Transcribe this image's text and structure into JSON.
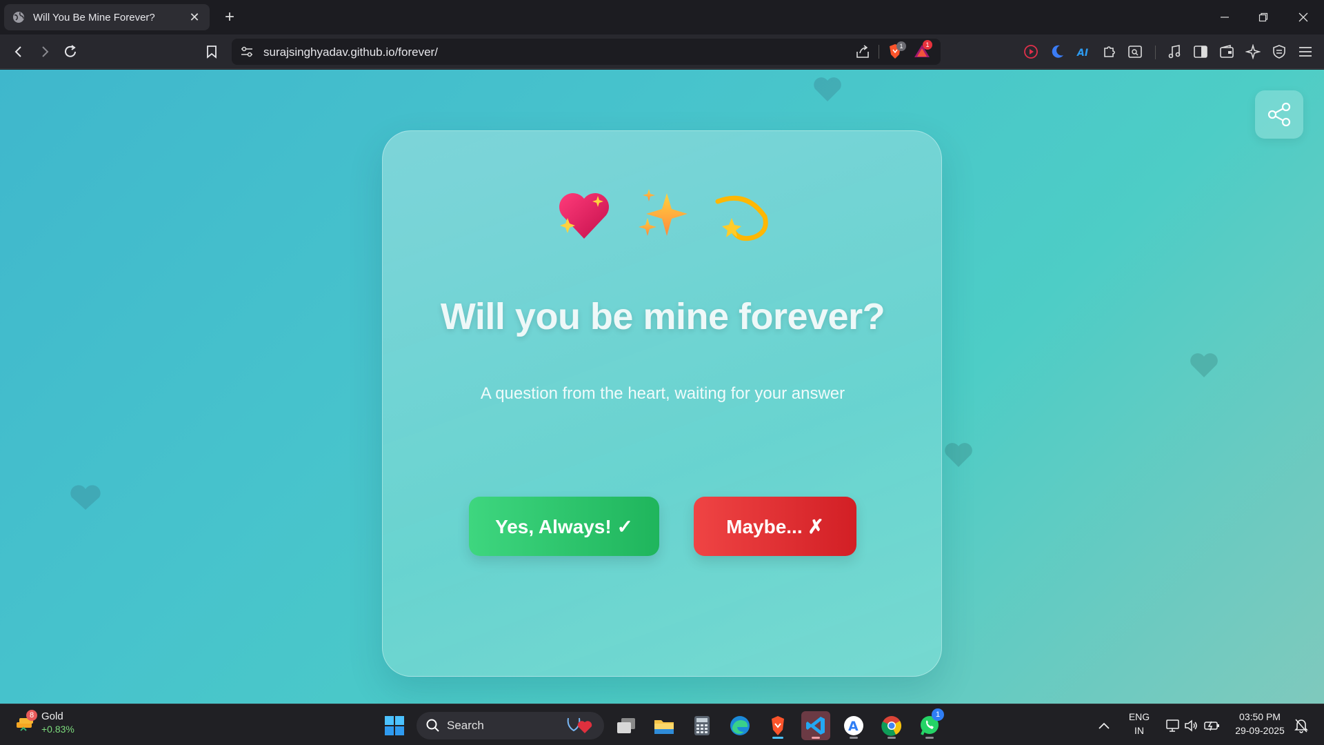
{
  "browser": {
    "tab_title": "Will You Be Mine Forever?",
    "url": "surajsinghyadav.github.io/forever/",
    "shield_badge": "1",
    "alert_badge": "1"
  },
  "page": {
    "emojis": [
      "sparkling-heart",
      "sparkles",
      "dizzy"
    ],
    "headline": "Will you be mine forever?",
    "subline": "A question from the heart, waiting for your answer",
    "yes_label": "Yes, Always! ✓",
    "no_label": "Maybe... ✗",
    "colors": {
      "yes": "#22c55e",
      "no": "#dc2626",
      "background": "#45c0cc"
    }
  },
  "taskbar": {
    "weather_label": "Gold",
    "weather_value": "+0.83%",
    "weather_badge": "8",
    "search_placeholder": "Search",
    "whatsapp_badge": "1",
    "lang_top": "ENG",
    "lang_bottom": "IN",
    "time": "03:50 PM",
    "date": "29-09-2025"
  }
}
